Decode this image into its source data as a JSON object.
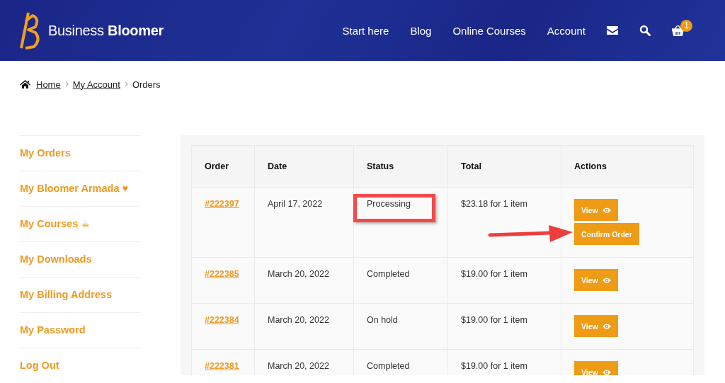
{
  "site": {
    "logo_light": "Business",
    "logo_bold": "Bloomer"
  },
  "nav": [
    {
      "label": "Start here"
    },
    {
      "label": "Blog"
    },
    {
      "label": "Online Courses"
    },
    {
      "label": "Account"
    }
  ],
  "cart_count": "1",
  "breadcrumb": [
    {
      "label": "Home",
      "link": true
    },
    {
      "label": "My Account",
      "link": true
    },
    {
      "label": "Orders",
      "link": false
    }
  ],
  "sidebar": {
    "items": [
      {
        "label": "My Orders"
      },
      {
        "label": "My Bloomer Armada ♥"
      },
      {
        "label": "My Courses ☕"
      },
      {
        "label": "My Downloads"
      },
      {
        "label": "My Billing Address"
      },
      {
        "label": "My Password"
      },
      {
        "label": "Log Out"
      }
    ]
  },
  "table": {
    "columns": [
      "Order",
      "Date",
      "Status",
      "Total",
      "Actions"
    ],
    "rows": [
      {
        "order": "#222397",
        "date": "April 17, 2022",
        "status": "Processing",
        "total": "$23.18 for 1 item",
        "status_highlighted": true,
        "actions": [
          {
            "kind": "view",
            "label": "View"
          },
          {
            "kind": "plain",
            "label": "Confirm Order",
            "arrow": true
          }
        ]
      },
      {
        "order": "#222385",
        "date": "March 20, 2022",
        "status": "Completed",
        "total": "$19.00 for 1 item",
        "status_highlighted": false,
        "actions": [
          {
            "kind": "view",
            "label": "View"
          }
        ]
      },
      {
        "order": "#222384",
        "date": "March 20, 2022",
        "status": "On hold",
        "total": "$19.00 for 1 item",
        "status_highlighted": false,
        "actions": [
          {
            "kind": "view",
            "label": "View"
          }
        ]
      },
      {
        "order": "#222381",
        "date": "March 20, 2022",
        "status": "Completed",
        "total": "$19.00 for 1 item",
        "status_highlighted": false,
        "actions": [
          {
            "kind": "view",
            "label": "View"
          }
        ]
      }
    ]
  }
}
